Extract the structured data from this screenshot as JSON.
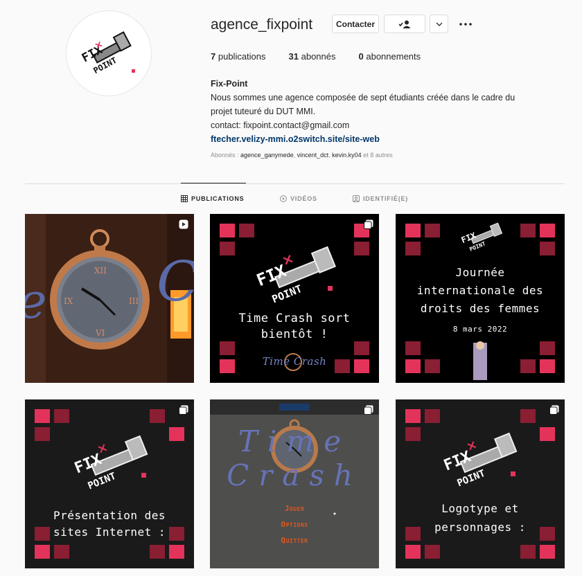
{
  "profile": {
    "username": "agence_fixpoint",
    "contact_label": "Contacter",
    "stats": {
      "posts_count": "7",
      "posts_label": "publications",
      "followers_count": "31",
      "followers_label": "abonnés",
      "following_count": "0",
      "following_label": "abonnements"
    },
    "bio": {
      "name": "Fix-Point",
      "line1": "Nous sommes une agence composée de sept étudiants créée dans le cadre du",
      "line2": "projet tuteuré du DUT MMI.",
      "line3": "contact: fixpoint.contact@gmail.com",
      "link": "ftecher.velizy-mmi.o2switch.site/site-web"
    },
    "followed_by": {
      "prefix": "Abonnés : ",
      "user1": "agence_ganymede",
      "user2": "vincent_dct",
      "user3": "kevin.ky04",
      "suffix": " et 8 autres"
    }
  },
  "tabs": [
    {
      "label": "PUBLICATIONS",
      "icon": "grid-icon"
    },
    {
      "label": "VIDÉOS",
      "icon": "play-icon"
    },
    {
      "label": "IDENTIFIÉ(E)",
      "icon": "tag-icon"
    }
  ],
  "posts": [
    {
      "type": "reel",
      "caption": ""
    },
    {
      "type": "carousel",
      "caption_line1": "Time Crash sort",
      "caption_line2": "bientôt !",
      "logo_text": "Time Crash"
    },
    {
      "type": "image",
      "caption_line1": "Journée",
      "caption_line2": "internationale des",
      "caption_line3": "droits des femmes",
      "date": "8 mars 2022"
    },
    {
      "type": "carousel",
      "caption_line1": "Présentation des",
      "caption_line2": "sites Internet :"
    },
    {
      "type": "carousel",
      "title": "Time Crash",
      "menu1": "Jouer",
      "menu2": "Options",
      "menu3": "Quitter"
    },
    {
      "type": "carousel",
      "caption_line1": "Logotype et",
      "caption_line2": "personnages :"
    }
  ],
  "colors": {
    "brand_red": "#e4335a",
    "dark_red": "#8a1e33",
    "link": "#00376b",
    "muted": "#8e8e8e"
  }
}
